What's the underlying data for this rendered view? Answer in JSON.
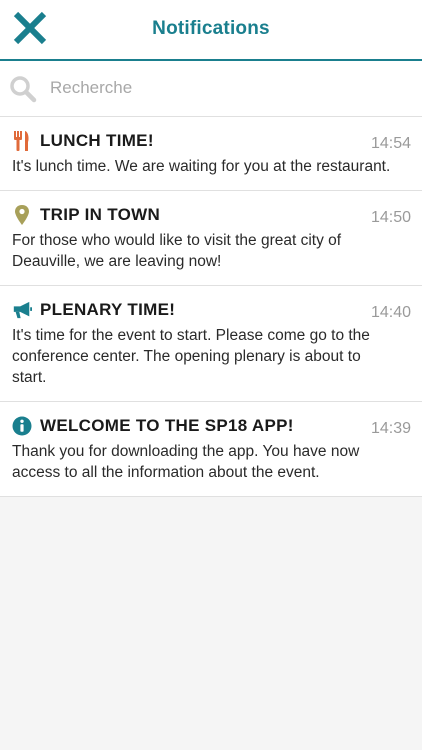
{
  "header": {
    "title": "Notifications",
    "close_icon": "close-icon"
  },
  "search": {
    "placeholder": "Recherche",
    "value": "",
    "icon": "search-icon"
  },
  "colors": {
    "accent": "#1a7f8e",
    "lunch_icon": "#e06a3a",
    "trip_icon": "#a8a05a",
    "plenary_icon": "#1a7f8e",
    "info_icon": "#1a7f8e"
  },
  "notifications": [
    {
      "icon": "fork-knife-icon",
      "title": "LUNCH TIME!",
      "time": "14:54",
      "body": "It's lunch time. We are waiting for you at the restaurant."
    },
    {
      "icon": "location-pin-icon",
      "title": "TRIP IN TOWN",
      "time": "14:50",
      "body": "For those who would like to visit the great city of Deauville, we are leaving now!"
    },
    {
      "icon": "megaphone-icon",
      "title": "PLENARY TIME!",
      "time": "14:40",
      "body": "It's time for the event to start. Please come go to the conference center. The opening plenary is about to start."
    },
    {
      "icon": "info-icon",
      "title": "WELCOME TO THE SP18 APP!",
      "time": "14:39",
      "body": "Thank you for downloading the app. You have now access to all the information about the event."
    }
  ]
}
